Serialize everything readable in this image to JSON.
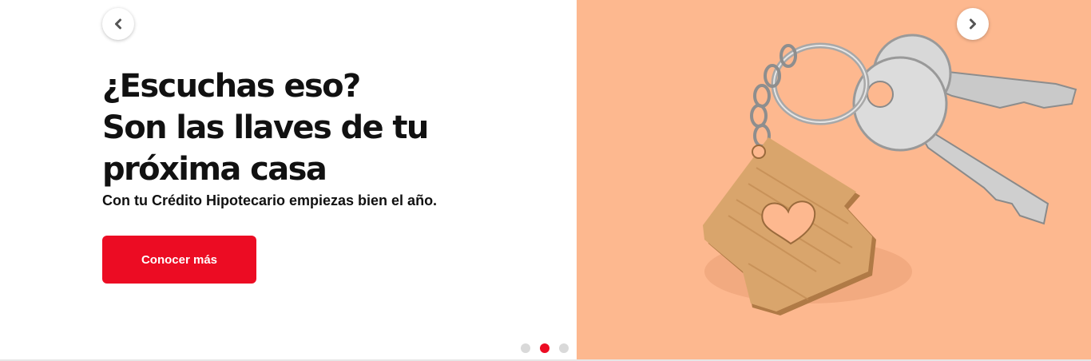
{
  "carousel": {
    "prev_icon": "chevron-left-icon",
    "next_icon": "chevron-right-icon",
    "active_slide": 2,
    "slide_count": 3
  },
  "slide": {
    "headline_lines": [
      "¿Escuchas eso?",
      "Son las llaves de tu",
      "próxima casa"
    ],
    "subtitle": "Con tu Crédito Hipotecario empiezas bien el año.",
    "cta_label": "Conocer más",
    "image_subject": "house-keychain-with-keys"
  },
  "colors": {
    "accent": "#ec0c23",
    "image_background": "#fdb88f",
    "text": "#111111",
    "dot_inactive": "#d9d9d9"
  }
}
